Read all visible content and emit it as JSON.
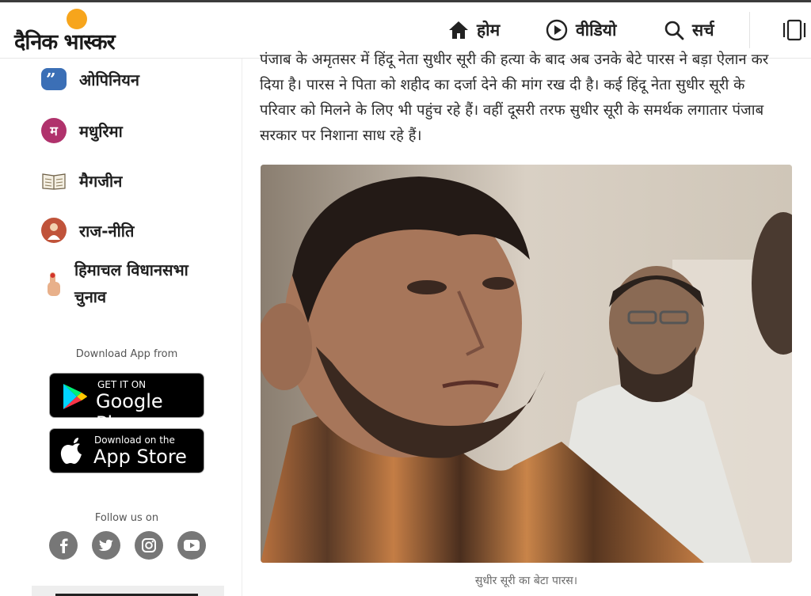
{
  "header": {
    "logo_text": "दैनिक भास्कर",
    "nav": [
      {
        "label": "होम",
        "icon": "home-icon"
      },
      {
        "label": "वीडियो",
        "icon": "play-icon"
      },
      {
        "label": "सर्च",
        "icon": "search-icon"
      }
    ],
    "menu_icon": "menu-icon"
  },
  "sidebar": {
    "items": [
      {
        "label": "ओपिनियन",
        "icon": "quote-icon",
        "color": "#3b6fb6"
      },
      {
        "label": "मधुरिमा",
        "icon": "madhurima-icon",
        "icon_text": "म",
        "color": "#b0326c"
      },
      {
        "label": "मैगजीन",
        "icon": "book-icon",
        "color": "#8a7a5a"
      },
      {
        "label": "राज-नीति",
        "icon": "politics-icon",
        "color": "#c0533a"
      },
      {
        "label": "हिमाचल विधानसभा चुनाव",
        "icon": "hand-vote-icon",
        "color": "#e0a070"
      }
    ],
    "download_label": "Download App from",
    "google_play": {
      "small": "GET IT ON",
      "big": "Google Play"
    },
    "app_store": {
      "small": "Download on the",
      "big": "App Store"
    },
    "follow_label": "Follow us on",
    "socials": [
      "facebook-icon",
      "twitter-icon",
      "instagram-icon",
      "youtube-icon"
    ]
  },
  "article": {
    "paragraph": "पंजाब के अमृतसर में हिंदू नेता सुधीर सूरी की हत्या के बाद अब उनके बेटे पारस ने बड़ा ऐलान कर दिया है। पारस ने पिता को शहीद का दर्जा देने की मांग रख दी है। कई हिंदू नेता सुधीर सूरी के परिवार को मिलने के लिए भी पहुंच रहे हैं। वहीं दूसरी तरफ सुधीर सूरी के समर्थक लगातार पंजाब सरकार पर निशाना साध रहे हैं।",
    "caption": "सुधीर सूरी का बेटा पारस।"
  },
  "colors": {
    "accent": "#f7a51c",
    "social_grey": "#777777"
  }
}
